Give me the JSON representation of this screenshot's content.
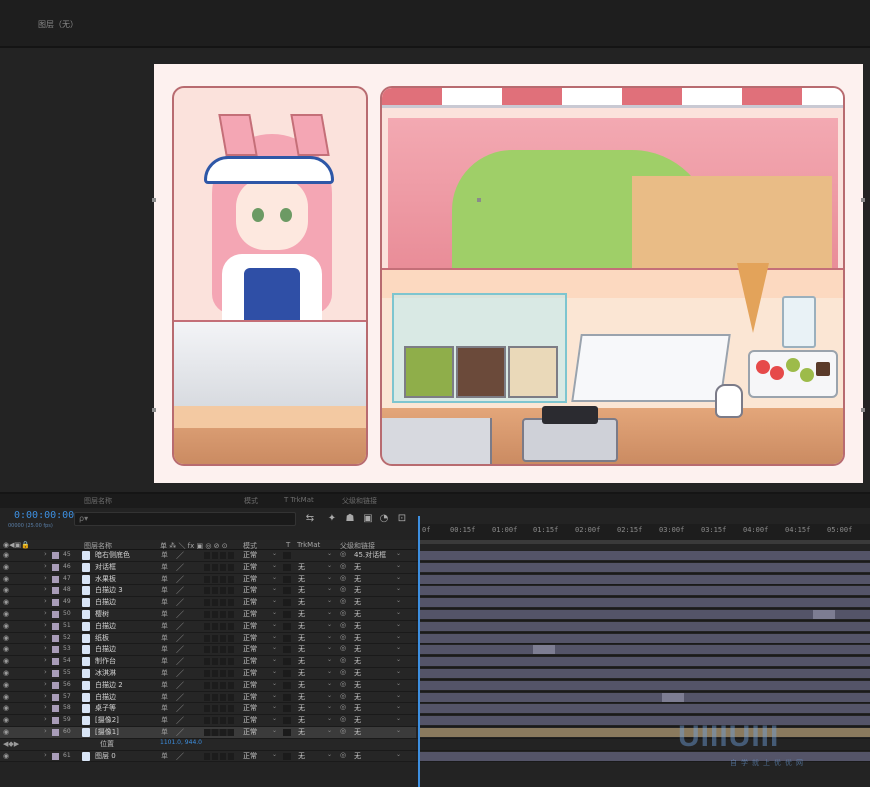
{
  "composition": {
    "title": "图层（无）"
  },
  "timeline": {
    "tabs": [
      "图层名称",
      "模式",
      "T TrkMat",
      "父级和链接"
    ],
    "timecode": "0:00:00:00",
    "fps": "00000 (25.00 fps)",
    "search_placeholder": "ρ▾",
    "ruler_ticks": [
      "0f",
      "00:15f",
      "01:00f",
      "01:15f",
      "02:00f",
      "02:15f",
      "03:00f",
      "03:15f",
      "04:00f",
      "04:15f",
      "05:00f"
    ],
    "columns": {
      "layer_name": "图层名称",
      "switches": "单 ⁂ ＼ fx ▣ ◎ ⊘ ⊙",
      "mode": "模式",
      "t": "T",
      "trkmat": "TrkMat",
      "parent": "父级和链接"
    },
    "layers": [
      {
        "num": "45",
        "name": "暗右侧底色",
        "mode": "正常",
        "trkmat": "",
        "parent": "45.对话框"
      },
      {
        "num": "46",
        "name": "对话框",
        "mode": "正常",
        "trkmat": "无",
        "parent": "无"
      },
      {
        "num": "47",
        "name": "水果板",
        "mode": "正常",
        "trkmat": "无",
        "parent": "无"
      },
      {
        "num": "48",
        "name": "白描边 3",
        "mode": "正常",
        "trkmat": "无",
        "parent": "无"
      },
      {
        "num": "49",
        "name": "白描边",
        "mode": "正常",
        "trkmat": "无",
        "parent": "无"
      },
      {
        "num": "50",
        "name": "樱树",
        "mode": "正常",
        "trkmat": "无",
        "parent": "无"
      },
      {
        "num": "51",
        "name": "白描边",
        "mode": "正常",
        "trkmat": "无",
        "parent": "无"
      },
      {
        "num": "52",
        "name": "纸板",
        "mode": "正常",
        "trkmat": "无",
        "parent": "无"
      },
      {
        "num": "53",
        "name": "白描边",
        "mode": "正常",
        "trkmat": "无",
        "parent": "无"
      },
      {
        "num": "54",
        "name": "制作台",
        "mode": "正常",
        "trkmat": "无",
        "parent": "无"
      },
      {
        "num": "55",
        "name": "冰淇淋",
        "mode": "正常",
        "trkmat": "无",
        "parent": "无"
      },
      {
        "num": "56",
        "name": "白描边 2",
        "mode": "正常",
        "trkmat": "无",
        "parent": "无"
      },
      {
        "num": "57",
        "name": "白描边",
        "mode": "正常",
        "trkmat": "无",
        "parent": "无"
      },
      {
        "num": "58",
        "name": "桌子等",
        "mode": "正常",
        "trkmat": "无",
        "parent": "无"
      },
      {
        "num": "59",
        "name": "[摄像2]",
        "mode": "正常",
        "trkmat": "无",
        "parent": "无"
      },
      {
        "num": "60",
        "name": "[摄像1]",
        "mode": "正常",
        "trkmat": "无",
        "parent": "无"
      },
      {
        "num": "61",
        "name": "图层 0",
        "mode": "正常",
        "trkmat": "无",
        "parent": "无"
      }
    ],
    "property": {
      "name": "位置",
      "value": "1101.0, 944.0"
    }
  },
  "watermark": {
    "logo": "UIIIUIII",
    "subtitle": "自学就上优优网"
  }
}
